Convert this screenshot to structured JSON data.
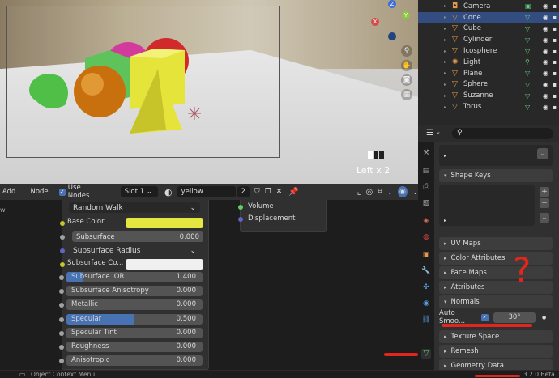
{
  "viewport": {
    "overlay_text": "Left x 2",
    "gizmo": {
      "x": "X",
      "y": "Y",
      "z": "Z"
    }
  },
  "outliner": {
    "items": [
      {
        "label": "Camera",
        "icon": "camera-icon",
        "sel": false
      },
      {
        "label": "Cone",
        "icon": "mesh-icon",
        "sel": true
      },
      {
        "label": "Cube",
        "icon": "mesh-icon",
        "sel": false
      },
      {
        "label": "Cylinder",
        "icon": "mesh-icon",
        "sel": false
      },
      {
        "label": "Icosphere",
        "icon": "mesh-icon",
        "sel": false
      },
      {
        "label": "Light",
        "icon": "light-icon",
        "sel": false
      },
      {
        "label": "Plane",
        "icon": "mesh-icon",
        "sel": false
      },
      {
        "label": "Sphere",
        "icon": "mesh-icon",
        "sel": false
      },
      {
        "label": "Suzanne",
        "icon": "mesh-icon",
        "sel": false
      },
      {
        "label": "Torus",
        "icon": "mesh-icon",
        "sel": false
      }
    ]
  },
  "node_header": {
    "add": "Add",
    "node": "Node",
    "use_nodes": "Use Nodes",
    "slot": "Slot 1",
    "material": "yellow",
    "users": "2"
  },
  "bsdf": {
    "subsurface_method": "Random Walk",
    "base_color_label": "Base Color",
    "subsurface": {
      "label": "Subsurface",
      "value": "0.000"
    },
    "subsurface_radius": "Subsurface Radius",
    "subsurface_color_label": "Subsurface Co...",
    "subsurface_ior": {
      "label": "Subsurface IOR",
      "value": "1.400"
    },
    "subsurface_aniso": {
      "label": "Subsurface Anisotropy",
      "value": "0.000"
    },
    "metallic": {
      "label": "Metallic",
      "value": "0.000"
    },
    "specular": {
      "label": "Specular",
      "value": "0.500"
    },
    "specular_tint": {
      "label": "Specular Tint",
      "value": "0.000"
    },
    "roughness": {
      "label": "Roughness",
      "value": "0.000"
    },
    "anisotropic": {
      "label": "Anisotropic",
      "value": "0.000"
    }
  },
  "output_node": {
    "volume": "Volume",
    "displacement": "Displacement"
  },
  "properties": {
    "shape_keys": "Shape Keys",
    "panels": [
      "UV Maps",
      "Color Attributes",
      "Face Maps",
      "Attributes"
    ],
    "normals": "Normals",
    "auto_smooth_label": "Auto Smoo...",
    "auto_smooth_value": "30°",
    "panels2": [
      "Texture Space",
      "Remesh",
      "Geometry Data"
    ]
  },
  "annotation": "?",
  "status": {
    "left": "Object Context Menu",
    "version": "3.2.0 Beta"
  },
  "colors": {
    "accent": "#4772b3",
    "selected_row": "#334d80",
    "base_color": "#e5e640",
    "red_mark": "#e0261d"
  }
}
